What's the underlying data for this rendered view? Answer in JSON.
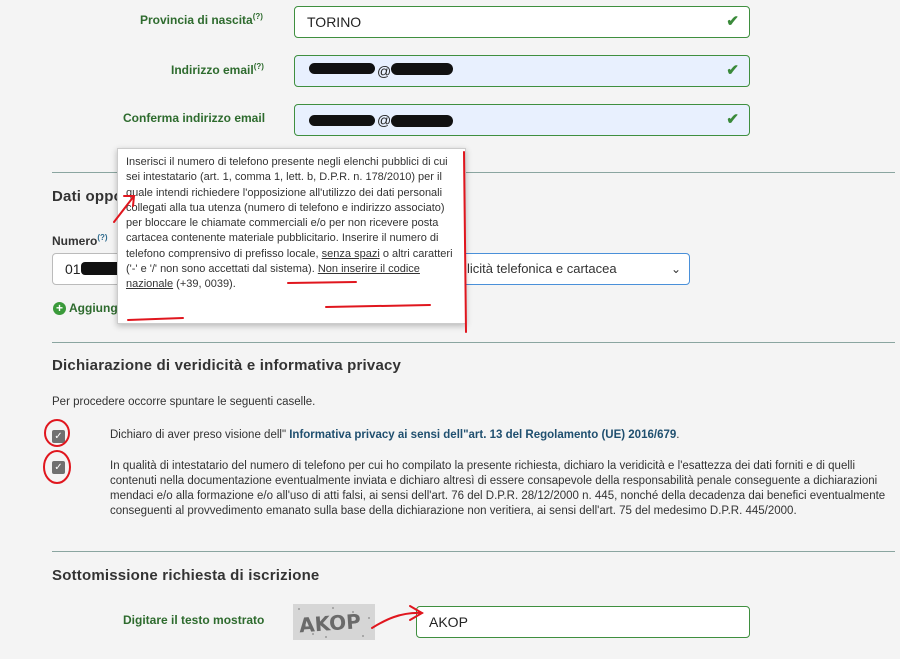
{
  "form": {
    "provincia": {
      "label": "Provincia di nascita",
      "help": "(?)",
      "value": "TORINO"
    },
    "email": {
      "label": "Indirizzo email",
      "help": "(?)",
      "value_visible": "@"
    },
    "conferma_email": {
      "label": "Conferma indirizzo email",
      "value_visible": "@"
    }
  },
  "section_dati": {
    "title_visible": "Dati oppo",
    "numero_label": "Numero",
    "numero_help": "(?)",
    "numero_value_visible": "01",
    "add_label_visible": "Aggiung",
    "select_value_visible": "licità telefonica e cartacea"
  },
  "tooltip": {
    "part1": "Inserisci il numero di telefono presente negli elenchi pubblici di cui sei intestatario (art. 1, comma 1, lett. b, D.P.R. n. 178/2010) per il quale intendi richiedere l'opposizione all'utilizzo dei dati personali collegati alla tua utenza (numero di telefono e indirizzo associato) per bloccare le chiamate commerciali e/o per non ricevere posta cartacea contenente materiale pubblicitario. Inserire il numero di telefono comprensivo di prefisso locale, ",
    "underline1": "senza spazi",
    "part2": " o altri caratteri ('-' e '/' non sono accettati dal sistema). ",
    "underline2": "Non inserire il codice nazionale",
    "part3": " (+39, 0039)."
  },
  "privacy": {
    "title": "Dichiarazione di veridicità e informativa privacy",
    "intro": "Per procedere occorre spuntare le seguenti caselle.",
    "check1_prefix": "Dichiaro di aver preso visione dell\"",
    "check1_link": " Informativa privacy ai sensi dell\"art. 13 del Regolamento (UE) 2016/679",
    "check1_suffix": ".",
    "check2": "In qualità di intestatario del numero di telefono per cui ho compilato la presente richiesta, dichiaro la veridicità e l'esattezza dei dati forniti e di quelli contenuti nella documentazione eventualmente inviata e dichiaro altresì di essere consapevole della responsabilità penale conseguente a dichiarazioni mendaci e/o alla formazione e/o all'uso di atti falsi, ai sensi dell'art. 76 del D.P.R. 28/12/2000 n. 445, nonché della decadenza dai benefici eventualmente conseguenti al provvedimento emanato sulla base della dichiarazione non veritiera, ai sensi dell'art. 75 del medesimo D.P.R. 445/2000."
  },
  "submit": {
    "title": "Sottomissione richiesta di iscrizione",
    "captcha_label": "Digitare il testo mostrato",
    "captcha_image_text": "AKOP",
    "captcha_input": "AKOP"
  },
  "colors": {
    "label_green": "#2e6b2e",
    "annotation_red": "#e0161e",
    "field_border": "#3f8f3f",
    "autofill_blue": "#e8f0fe"
  }
}
